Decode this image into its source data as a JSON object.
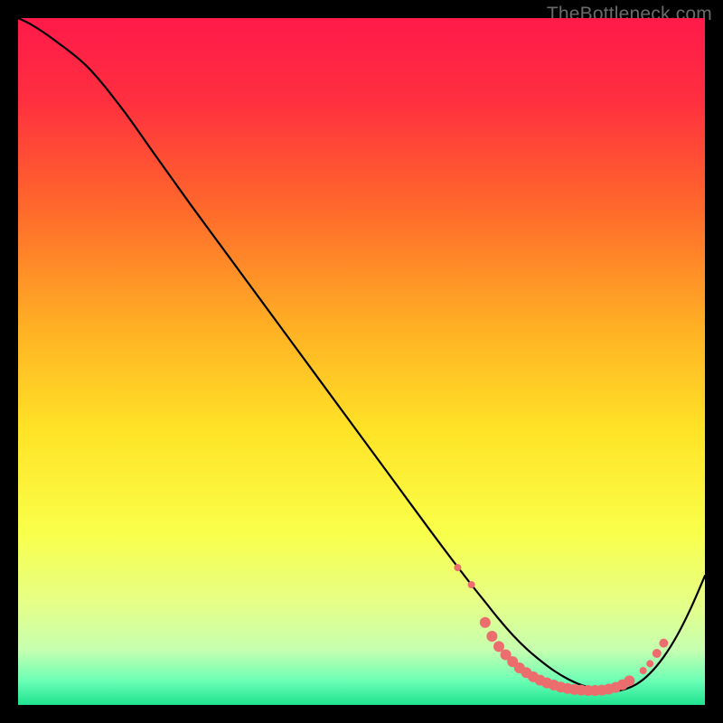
{
  "watermark": "TheBottleneck.com",
  "gradient": {
    "stops": [
      {
        "offset": 0.0,
        "color": "#ff1a4a"
      },
      {
        "offset": 0.12,
        "color": "#ff2f3f"
      },
      {
        "offset": 0.28,
        "color": "#ff6a2b"
      },
      {
        "offset": 0.45,
        "color": "#ffb024"
      },
      {
        "offset": 0.6,
        "color": "#ffe326"
      },
      {
        "offset": 0.75,
        "color": "#f9ff4a"
      },
      {
        "offset": 0.85,
        "color": "#e6ff86"
      },
      {
        "offset": 0.92,
        "color": "#c6ffb0"
      },
      {
        "offset": 0.965,
        "color": "#6bffb5"
      },
      {
        "offset": 1.0,
        "color": "#1fe290"
      }
    ]
  },
  "chart_data": {
    "type": "line",
    "title": "",
    "xlabel": "",
    "ylabel": "",
    "xlim": [
      0,
      100
    ],
    "ylim": [
      0,
      100
    ],
    "series": [
      {
        "name": "curve",
        "x": [
          0,
          2,
          5,
          10,
          15,
          20,
          25,
          30,
          35,
          40,
          45,
          50,
          55,
          60,
          63,
          66,
          68,
          70,
          72,
          74,
          76,
          78,
          80,
          82,
          84,
          86,
          88,
          90,
          92,
          94,
          96,
          98,
          100
        ],
        "y": [
          100,
          99,
          97,
          93,
          87,
          80,
          73,
          66.2,
          59.4,
          52.6,
          45.8,
          39,
          32.2,
          25.4,
          21.4,
          17.5,
          15,
          12.5,
          10.2,
          8.2,
          6.5,
          5.0,
          3.8,
          2.9,
          2.3,
          2.0,
          2.2,
          3.0,
          4.6,
          7.0,
          10.2,
          14.2,
          18.8
        ]
      }
    ],
    "markers": {
      "comment": "highlighted points near the minimum",
      "color": "#ec6d6d",
      "points": [
        {
          "x": 64,
          "y": 20.0,
          "r": 4
        },
        {
          "x": 66,
          "y": 17.5,
          "r": 4
        },
        {
          "x": 68,
          "y": 12.0,
          "r": 6
        },
        {
          "x": 69,
          "y": 10.0,
          "r": 6
        },
        {
          "x": 70,
          "y": 8.5,
          "r": 6
        },
        {
          "x": 71,
          "y": 7.3,
          "r": 6
        },
        {
          "x": 72,
          "y": 6.3,
          "r": 6
        },
        {
          "x": 73,
          "y": 5.4,
          "r": 6
        },
        {
          "x": 74,
          "y": 4.7,
          "r": 6
        },
        {
          "x": 75,
          "y": 4.1,
          "r": 6
        },
        {
          "x": 76,
          "y": 3.6,
          "r": 6
        },
        {
          "x": 77,
          "y": 3.2,
          "r": 6
        },
        {
          "x": 78,
          "y": 2.9,
          "r": 6
        },
        {
          "x": 79,
          "y": 2.6,
          "r": 6
        },
        {
          "x": 80,
          "y": 2.4,
          "r": 6
        },
        {
          "x": 81,
          "y": 2.25,
          "r": 6
        },
        {
          "x": 82,
          "y": 2.15,
          "r": 6
        },
        {
          "x": 83,
          "y": 2.1,
          "r": 6
        },
        {
          "x": 84,
          "y": 2.1,
          "r": 6
        },
        {
          "x": 85,
          "y": 2.15,
          "r": 6
        },
        {
          "x": 86,
          "y": 2.3,
          "r": 6
        },
        {
          "x": 87,
          "y": 2.55,
          "r": 6
        },
        {
          "x": 88,
          "y": 2.95,
          "r": 6
        },
        {
          "x": 89,
          "y": 3.5,
          "r": 6
        },
        {
          "x": 91,
          "y": 5.0,
          "r": 4
        },
        {
          "x": 92,
          "y": 6.0,
          "r": 4
        },
        {
          "x": 93,
          "y": 7.5,
          "r": 5
        },
        {
          "x": 94,
          "y": 9.0,
          "r": 5
        }
      ]
    }
  }
}
